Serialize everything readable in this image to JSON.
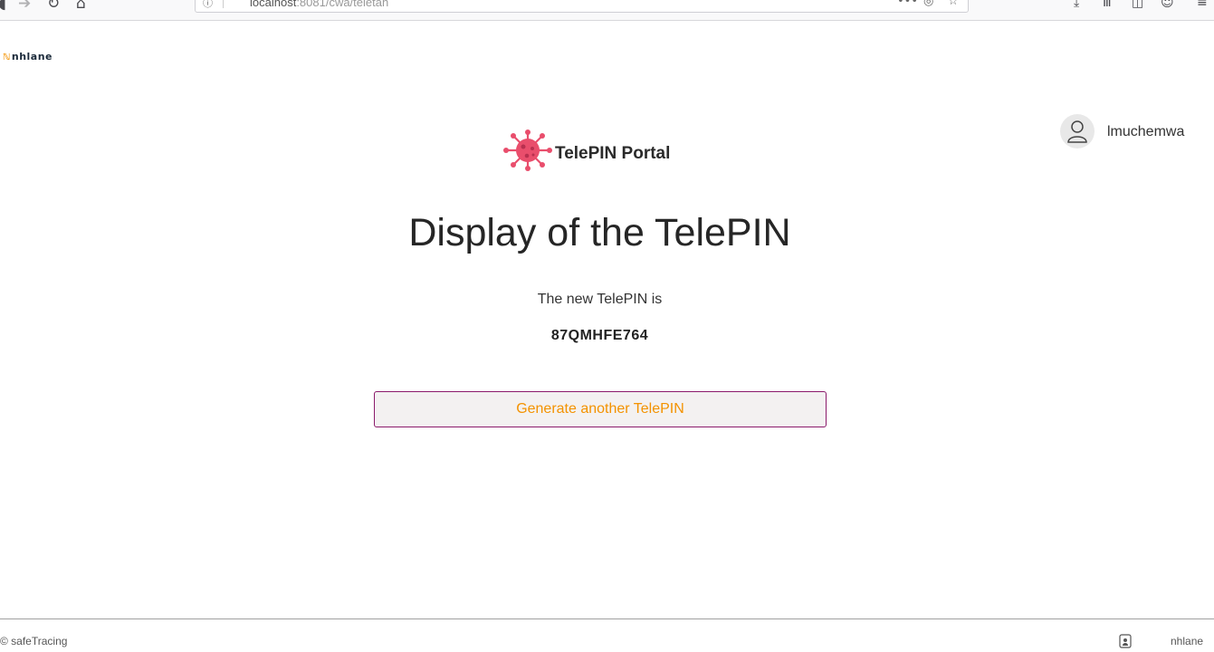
{
  "browser": {
    "url_host": "localhost",
    "url_port_path": ":8081/cwa/teletan",
    "back_icon": "back-arrow-icon",
    "forward_icon": "forward-arrow-icon",
    "reload_icon": "reload-icon",
    "home_icon": "home-icon"
  },
  "page": {
    "brand_logo_text": "nhlane",
    "portal_title": "TelePIN Portal",
    "user_name": "lmuchemwa",
    "heading": "Display of the TelePIN",
    "subtitle": "The new TelePIN is",
    "pin": "87QMHFE764",
    "generate_button": "Generate another TelePIN"
  },
  "footer": {
    "copyright": "© safeTracing",
    "brand": "nhlane"
  },
  "colors": {
    "accent": "#f39200",
    "button_border": "#8b1a6b",
    "virus": "#e94e6c"
  }
}
